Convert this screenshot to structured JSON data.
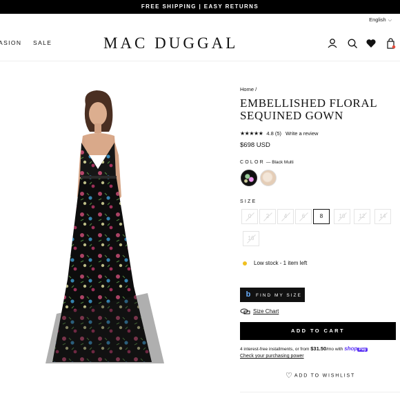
{
  "promo_banner": "FREE SHIPPING | EASY RETURNS",
  "language": "English",
  "nav": {
    "left_items": [
      "ASION",
      "SALE"
    ]
  },
  "brand": "MAC DUGGAL",
  "header_icons": [
    "account-icon",
    "search-icon",
    "heart-icon",
    "cart-icon"
  ],
  "breadcrumb": "Home /",
  "product": {
    "title": "EMBELLISHED FLORAL SEQUINED GOWN",
    "rating_stars": "★★★★★",
    "rating_score": "4.8 (5)",
    "write_review": "Write a review",
    "price": "$698 USD",
    "color_label": "COLOR",
    "color_value": "— Black Multi",
    "size_label": "SIZE",
    "sizes": [
      "0",
      "2",
      "4",
      "6",
      "8",
      "10",
      "12",
      "14",
      "16"
    ],
    "selected_size": "8",
    "stock_text": "Low stock - 1 item left",
    "find_my_size": "FIND MY SIZE",
    "size_chart": "Size Chart",
    "add_to_cart": "ADD TO CART",
    "installments_prefix": "4 interest-free installments, or from ",
    "installments_amount": "$31.50",
    "installments_suffix": "/mo with ",
    "shop_pay_shop": "shop",
    "shop_pay_pay": "Pay",
    "check_power": "Check your purchasing power",
    "add_to_wishlist": "ADD TO WISHLIST"
  },
  "colors": {
    "accent": "#000000",
    "stock_dot": "#f0c020",
    "shop_pay": "#5a31f4"
  }
}
